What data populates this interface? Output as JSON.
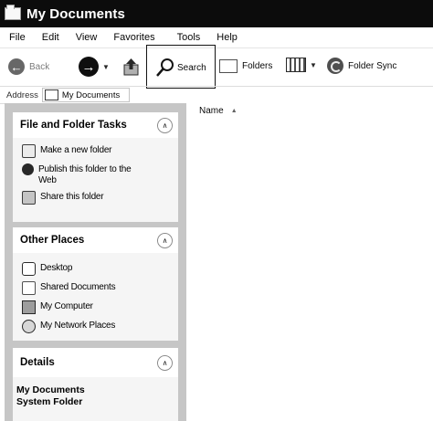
{
  "window": {
    "title": "My Documents"
  },
  "menu": {
    "items": [
      {
        "label": "File"
      },
      {
        "label": "Edit"
      },
      {
        "label": "View"
      },
      {
        "label": "Favorites"
      },
      {
        "label": "Tools"
      },
      {
        "label": "Help"
      }
    ]
  },
  "toolbar": {
    "back_label": "Back",
    "search_label": "Search",
    "folders_label": "Folders",
    "folder_sync_label": "Folder Sync",
    "icons": {
      "back": "back-arrow-icon",
      "forward": "forward-arrow-icon",
      "up": "up-folder-icon",
      "search": "magnifier-icon",
      "folders": "folders-icon",
      "views": "views-icon",
      "folder_sync": "folder-sync-icon"
    }
  },
  "address": {
    "label": "Address",
    "value": "My Documents"
  },
  "task_pane": {
    "file_folder_tasks": {
      "title": "File and Folder Tasks",
      "links": [
        {
          "label": "Make a new folder",
          "icon": "new-folder-icon"
        },
        {
          "label": "Publish this folder to the Web",
          "icon": "publish-web-icon"
        },
        {
          "label": "Share this folder",
          "icon": "share-folder-icon"
        }
      ]
    },
    "other_places": {
      "title": "Other Places",
      "links": [
        {
          "label": "Desktop",
          "icon": "desktop-icon"
        },
        {
          "label": "Shared Documents",
          "icon": "shared-documents-icon"
        },
        {
          "label": "My Computer",
          "icon": "my-computer-icon"
        },
        {
          "label": "My Network Places",
          "icon": "network-places-icon"
        }
      ]
    },
    "details": {
      "title": "Details",
      "name": "My Documents",
      "type": "System Folder"
    }
  },
  "file_list": {
    "columns": [
      {
        "label": "Name",
        "sort": "ascending"
      }
    ]
  }
}
